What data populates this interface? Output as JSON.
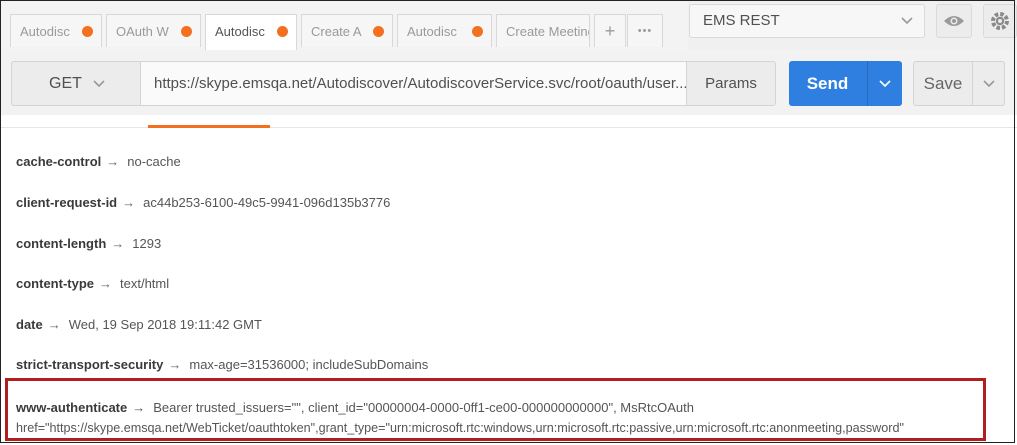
{
  "tabs": [
    {
      "label": "Autodisc",
      "active": false
    },
    {
      "label": "OAuth W",
      "active": false
    },
    {
      "label": "Autodisc",
      "active": true
    },
    {
      "label": "Create A",
      "active": false
    },
    {
      "label": "Autodisc",
      "active": false
    },
    {
      "label": "Create Meetings",
      "active": false
    }
  ],
  "tab_actions": {
    "add": "+",
    "more": "•••"
  },
  "environment": {
    "selected": "EMS REST"
  },
  "request": {
    "method": "GET",
    "url": "https://skype.emsqa.net/Autodiscover/AutodiscoverService.svc/root/oauth/user...",
    "params_label": "Params",
    "send_label": "Send",
    "save_label": "Save"
  },
  "arrow": "→",
  "headers": [
    {
      "key": "cache-control",
      "value": "no-cache"
    },
    {
      "key": "client-request-id",
      "value": "ac44b253-6100-49c5-9941-096d135b3776"
    },
    {
      "key": "content-length",
      "value": "1293"
    },
    {
      "key": "content-type",
      "value": "text/html"
    },
    {
      "key": "date",
      "value": "Wed, 19 Sep 2018 19:11:42 GMT"
    },
    {
      "key": "strict-transport-security",
      "value": "max-age=31536000; includeSubDomains"
    }
  ],
  "www_authenticate": {
    "key": "www-authenticate",
    "value_line1": "Bearer trusted_issuers=\"\", client_id=\"00000004-0000-0ff1-ce00-000000000000\", MsRtcOAuth",
    "value_line2": "href=\"https://skype.emsqa.net/WebTicket/oauthtoken\",grant_type=\"urn:microsoft.rtc:windows,urn:microsoft.rtc:passive,urn:microsoft.rtc:anonmeeting,password\""
  },
  "colors": {
    "accent": "#f37021",
    "send": "#2f7fe0",
    "highlight": "#b01e1e"
  }
}
